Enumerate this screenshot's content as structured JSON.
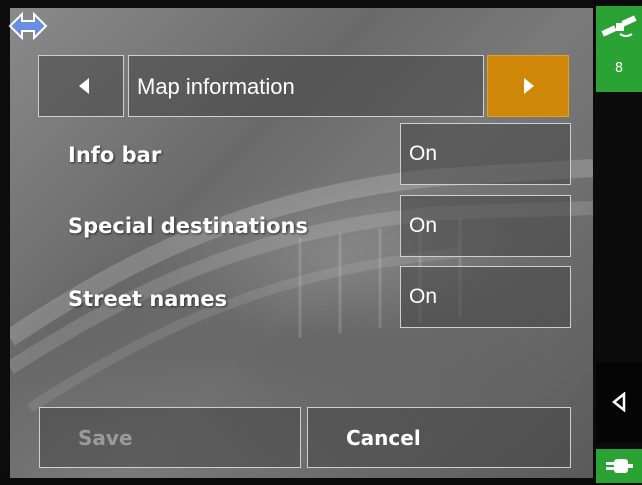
{
  "header": {
    "title": "Map information"
  },
  "settings": [
    {
      "label": "Info bar",
      "value": "On"
    },
    {
      "label": "Special destinations",
      "value": "On"
    },
    {
      "label": "Street names",
      "value": "On"
    }
  ],
  "footer": {
    "save_label": "Save",
    "cancel_label": "Cancel"
  },
  "status": {
    "gps_satellites": "8"
  },
  "icons": {
    "nav": "arrows-icon",
    "gps": "satellite-icon",
    "back": "back-arrow-icon",
    "power": "power-plug-icon",
    "prev": "triangle-left-icon",
    "next": "triangle-right-icon"
  },
  "colors": {
    "accent": "#cf8708",
    "status_green": "#2aa334"
  }
}
